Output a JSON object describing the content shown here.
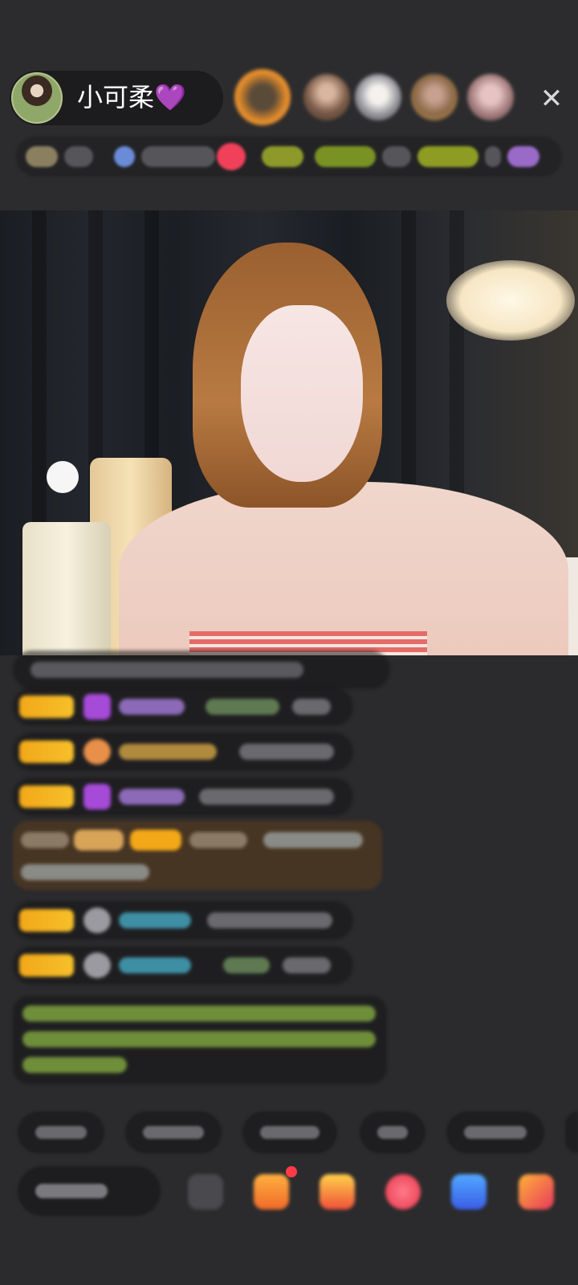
{
  "header": {
    "host_name": "小可柔💜",
    "close_glyph": "✕"
  },
  "colors": {
    "background": "#2b2b2d",
    "badge": "#f2a818",
    "pill": "#1c1c1e",
    "accent_pink": "#ff3b6a"
  },
  "icons": [
    "host-avatar",
    "viewer-avatar",
    "close-icon",
    "gift-icon",
    "heart-icon",
    "more-icon"
  ]
}
